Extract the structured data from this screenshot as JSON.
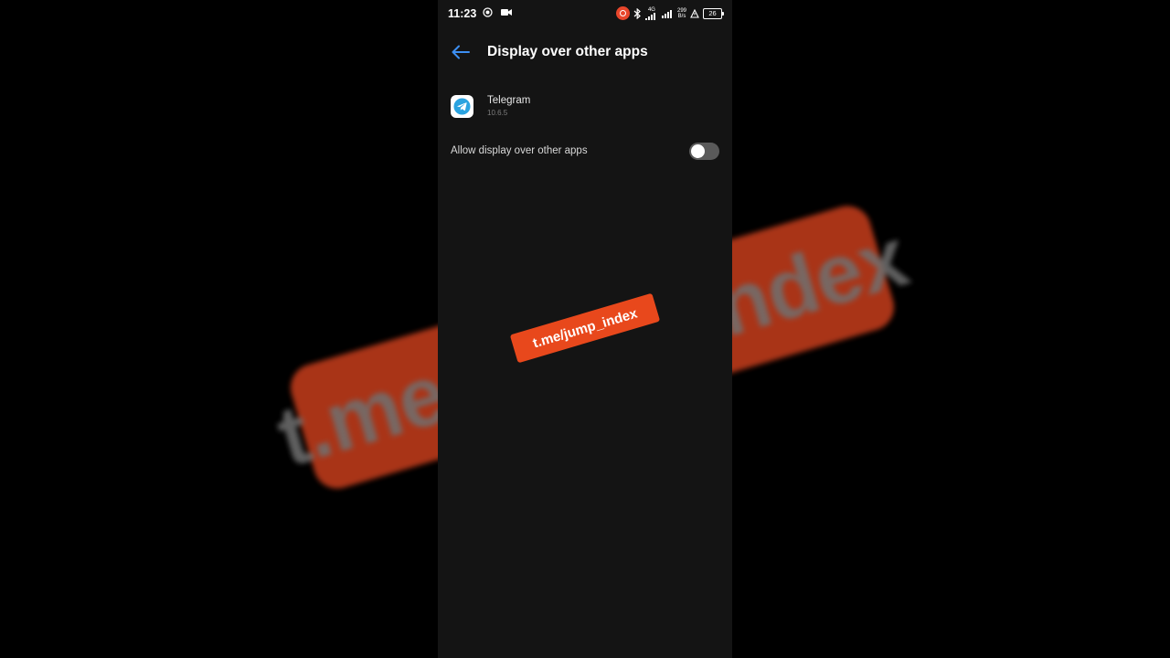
{
  "status_bar": {
    "time": "11:23",
    "network_type": "4G",
    "speed_value": "299",
    "speed_unit": "B/s",
    "battery": "26"
  },
  "header": {
    "title": "Display over other apps",
    "back_icon": "arrow-left-icon"
  },
  "app": {
    "name": "Telegram",
    "version": "10.6.5",
    "icon": "telegram-icon"
  },
  "permission": {
    "label": "Allow display over other apps",
    "enabled": false
  },
  "overlay": {
    "watermark_text": "t.me/jump_index",
    "background_watermark_text": "t.me/jump_index"
  },
  "colors": {
    "accent": "#3d8ff2",
    "watermark": "#e8481c",
    "screen_background": "#141414",
    "toggle_off": "#5a5a5a"
  }
}
